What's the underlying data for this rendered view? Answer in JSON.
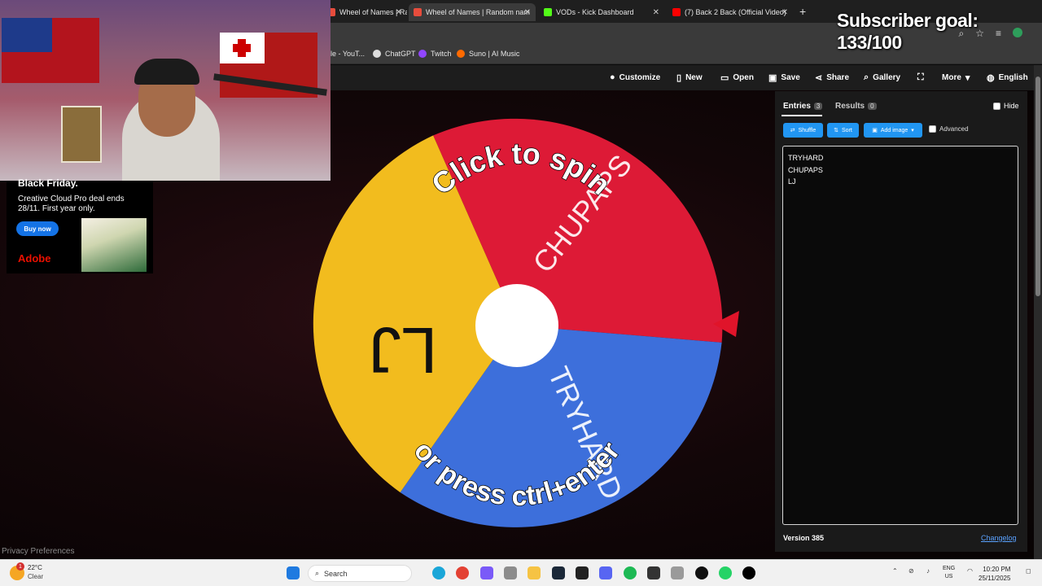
{
  "browser": {
    "tabs": [
      {
        "label": "Wheel of Names | Random nam",
        "active": false,
        "color": "#e74c3c"
      },
      {
        "label": "Wheel of Names | Random nam",
        "active": true,
        "color": "#e74c3c"
      },
      {
        "label": "VODs - Kick Dashboard",
        "active": false,
        "color": "#53fc18"
      },
      {
        "label": "(7) Back 2 Back (Official Video)",
        "active": false,
        "color": "#ff0000"
      }
    ],
    "bookmarks": [
      {
        "label": "le - YouT...",
        "color": "#ff0000"
      },
      {
        "label": "ChatGPT",
        "color": "#ffffff"
      },
      {
        "label": "Twitch",
        "color": "#9146ff"
      },
      {
        "label": "Suno | AI Music",
        "color": "#ff6a00"
      }
    ]
  },
  "overlay": {
    "subscriber_goal": "Subscriber goal: 133/100"
  },
  "ad": {
    "title": "Black Friday.",
    "text": "Creative Cloud Pro deal ends 28/11. First year only.",
    "button": "Buy now",
    "brand": "Adobe"
  },
  "privacy": "Privacy Preferences",
  "nav": {
    "customize": "Customize",
    "new": "New",
    "open": "Open",
    "save": "Save",
    "share": "Share",
    "gallery": "Gallery",
    "more": "More",
    "language": "English"
  },
  "wheel": {
    "slices": [
      {
        "label": "CHUPAPS",
        "color": "#dd1a36"
      },
      {
        "label": "TRYHARD",
        "color": "#3d6fdb"
      },
      {
        "label": "LJ",
        "color": "#f2bc1e"
      }
    ],
    "top_text": "Click to spin",
    "bottom_text": "or press ctrl+enter",
    "pointer_color": "#e0142a"
  },
  "panel": {
    "entries_tab": "Entries",
    "entries_count": "3",
    "results_tab": "Results",
    "results_count": "0",
    "hide": "Hide",
    "shuffle": "Shuffle",
    "sort": "Sort",
    "add_image": "Add image",
    "advanced": "Advanced",
    "entries": [
      "TRYHARD",
      "CHUPAPS",
      "LJ"
    ],
    "version": "Version 385",
    "changelog": "Changelog"
  },
  "taskbar": {
    "weather_temp": "22°C",
    "weather_cond": "Clear",
    "notif_count": "1",
    "search": "Search",
    "lang_top": "ENG",
    "lang_bottom": "US",
    "time": "10:20 PM",
    "date": "25/11/2025"
  }
}
